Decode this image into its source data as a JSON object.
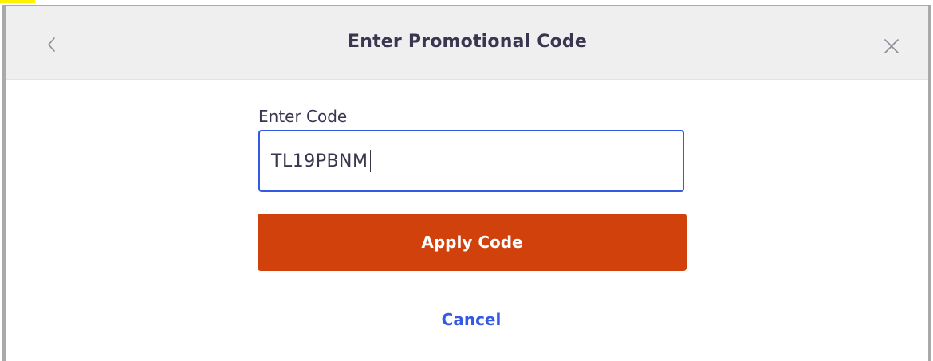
{
  "modal": {
    "title": "Enter Promotional Code",
    "back_icon": "chevron-left-icon",
    "close_icon": "close-icon"
  },
  "form": {
    "label": "Enter Code",
    "code_value": "TL19PBNM"
  },
  "actions": {
    "apply_label": "Apply Code",
    "cancel_label": "Cancel"
  },
  "colors": {
    "header_bg": "#efeff0",
    "primary_button": "#d1410c",
    "input_border_focus": "#3659e3",
    "link": "#3659e3",
    "title_text": "#39364f",
    "highlight": "#fff200"
  }
}
